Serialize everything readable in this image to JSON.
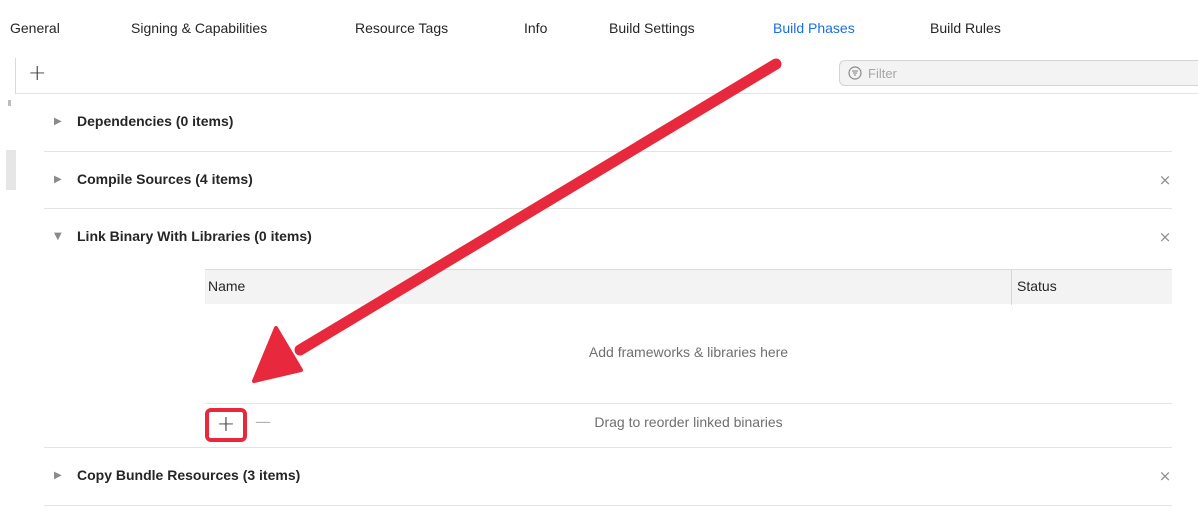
{
  "tabs": [
    {
      "label": "General",
      "active": false
    },
    {
      "label": "Signing & Capabilities",
      "active": false
    },
    {
      "label": "Resource Tags",
      "active": false
    },
    {
      "label": "Info",
      "active": false
    },
    {
      "label": "Build Settings",
      "active": false
    },
    {
      "label": "Build Phases",
      "active": true
    },
    {
      "label": "Build Rules",
      "active": false
    }
  ],
  "toolbar": {
    "add_icon": "plus-icon",
    "filter_placeholder": "Filter",
    "filter_icon": "filter-icon",
    "filter_value": ""
  },
  "phases": [
    {
      "title": "Dependencies (0 items)",
      "expanded": false,
      "removable": false
    },
    {
      "title": "Compile Sources (4 items)",
      "expanded": false,
      "removable": true
    },
    {
      "title": "Link Binary With Libraries (0 items)",
      "expanded": true,
      "removable": true
    },
    {
      "title": "Copy Bundle Resources (3 items)",
      "expanded": false,
      "removable": true
    }
  ],
  "glyphs": {
    "collapsed": "▶",
    "expanded": "▼",
    "close": "×",
    "add": "+",
    "remove": "—"
  },
  "library_table": {
    "columns": [
      "Name",
      "Status"
    ],
    "empty_message": "Add frameworks & libraries here",
    "reorder_hint": "Drag to reorder linked binaries"
  },
  "colors": {
    "accent": "#1a6fe0",
    "annotation": "#e8293d"
  }
}
